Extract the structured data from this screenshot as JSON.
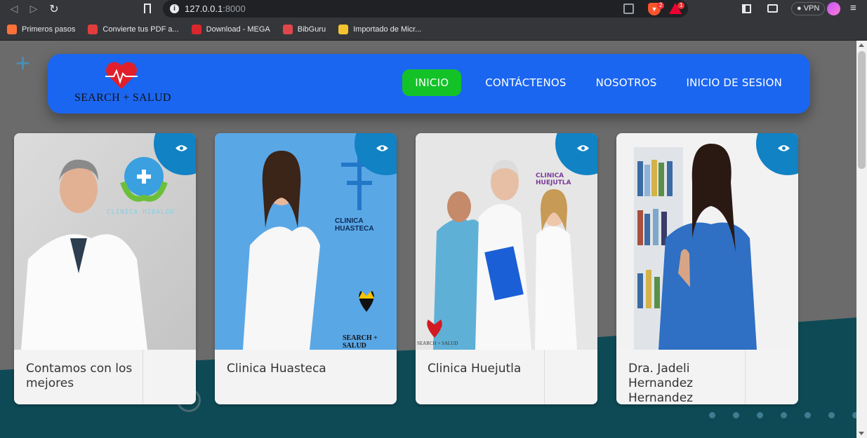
{
  "browser": {
    "url_host": "127.0.0.1",
    "url_port": ":8000",
    "vpn_label": "VPN",
    "brave_badge": "2",
    "alert_badge": "1"
  },
  "bookmarks": [
    {
      "label": "Primeros pasos",
      "color": "#ff7139"
    },
    {
      "label": "Convierte tus PDF a...",
      "color": "#e23d3d"
    },
    {
      "label": "Download - MEGA",
      "color": "#d9272e"
    },
    {
      "label": "BibGuru",
      "color": "#e0474c"
    },
    {
      "label": "Importado de Micr...",
      "color": "#f4c430"
    }
  ],
  "site": {
    "brand": "SEARCH + SALUD",
    "nav": [
      {
        "label": "INICIO"
      },
      {
        "label": "CONTÁCTENOS"
      },
      {
        "label": "NOSOTROS"
      },
      {
        "label": "INICIO DE SESION"
      }
    ],
    "cards": [
      {
        "title": "Contamos con los mejores",
        "overlay": "CLINICA HIDALGO"
      },
      {
        "title": "Clinica Huasteca",
        "overlay": "CLINICA HUASTECA",
        "overlay2": "SEARCH + SALUD"
      },
      {
        "title": "Clinica Huejutla",
        "overlay": "CLINICA HUEJUTLA",
        "overlay2": "SEARCH + SALUD"
      },
      {
        "title": "Dra. Jadeli Hernandez Hernandez"
      }
    ]
  },
  "colors": {
    "navbar": "#1b66f0",
    "active_nav": "#12c227",
    "card_corner": "#1182c4",
    "teal_bg": "#0e4a55"
  }
}
